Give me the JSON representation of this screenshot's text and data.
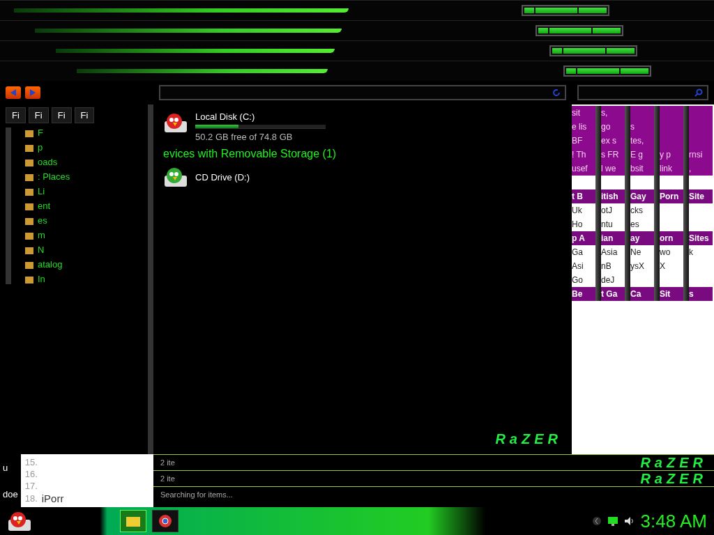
{
  "explorer": {
    "menu_labels": [
      "Fi",
      "Fi",
      "Fi",
      "Fi"
    ],
    "sidebar": [
      "F",
      "p",
      "oads",
      ": Places",
      "Li",
      "ent",
      "es",
      "m",
      "N",
      "atalog",
      "In"
    ],
    "drives": [
      {
        "name": "Local Disk (C:)",
        "kind": "disk",
        "level": 0.33,
        "detail": "50.2 GB free of 74.8 GB"
      }
    ],
    "section": "evices with Removable Storage (1)",
    "removable": [
      {
        "name": "CD Drive (D:)",
        "kind": "cd"
      }
    ],
    "logos": [
      "RaZER",
      "RaZER",
      "RaZER"
    ],
    "status": [
      "2 ite",
      "2 ite",
      "Searching for items..."
    ]
  },
  "browser": {
    "rows": [
      {
        "kind": "intro",
        "parts": [
          "sit",
          "s,"
        ]
      },
      {
        "kind": "intro",
        "parts": [
          "e lis",
          "go",
          "s"
        ]
      },
      {
        "kind": "intro",
        "parts": [
          "BF",
          "ex s",
          "tes,"
        ]
      },
      {
        "kind": "intro",
        "parts": [
          "! Th",
          "s FR",
          "E g",
          "y p",
          "rnsi"
        ]
      },
      {
        "kind": "intro",
        "parts": [
          "usef",
          "l we",
          "bsit",
          "link",
          ","
        ]
      },
      {
        "kind": "gap"
      },
      {
        "kind": "heading",
        "parts": [
          "t B",
          "itish",
          "Gay",
          "Porn",
          "Site"
        ]
      },
      {
        "kind": "link",
        "parts": [
          "Uk",
          "otJ",
          "cks"
        ]
      },
      {
        "kind": "link",
        "parts": [
          "Ho",
          "ntu",
          "es"
        ]
      },
      {
        "kind": "heading",
        "parts": [
          "p A",
          "ian",
          "ay",
          "orn",
          "Sites"
        ]
      },
      {
        "kind": "link",
        "parts": [
          "Ga",
          "Asia",
          "Ne",
          "wo",
          "k"
        ]
      },
      {
        "kind": "link",
        "parts": [
          "Asi",
          "nB",
          "ysX",
          "X"
        ]
      },
      {
        "kind": "link",
        "parts": [
          "Go",
          "deJ"
        ]
      },
      {
        "kind": "heading",
        "parts": [
          "Be",
          "t Ga",
          "Ca",
          "Sit",
          "s"
        ]
      }
    ]
  },
  "list": {
    "side": [
      "u",
      "doe"
    ],
    "items": [
      {
        "num": "15."
      },
      {
        "num": "16."
      },
      {
        "num": "17."
      },
      {
        "num": "18.",
        "text": "iPorr"
      }
    ]
  },
  "taskbar": {
    "apps": [
      {
        "kind": "folder",
        "selected": true
      },
      {
        "kind": "browser",
        "selected": false
      }
    ],
    "clock": "3:48 AM"
  }
}
